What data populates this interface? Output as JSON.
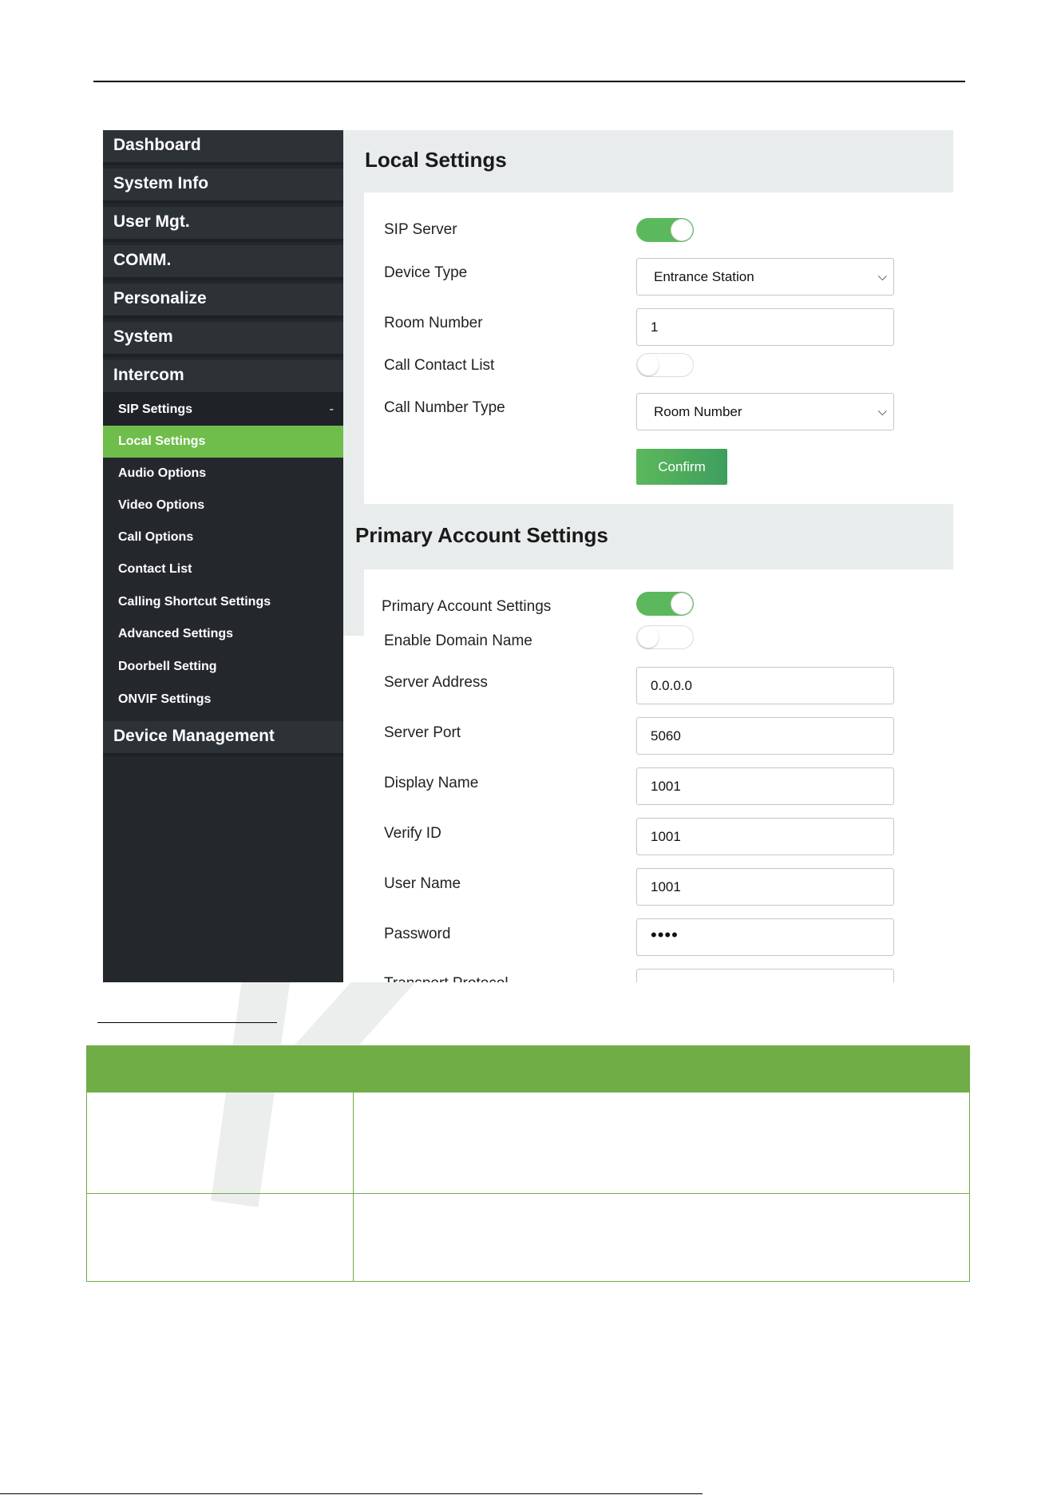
{
  "sidebar": {
    "main_items": [
      {
        "label": "Dashboard"
      },
      {
        "label": "System Info"
      },
      {
        "label": "User Mgt."
      },
      {
        "label": "COMM."
      },
      {
        "label": "Personalize"
      },
      {
        "label": "System"
      },
      {
        "label": "Intercom"
      }
    ],
    "sip_settings": {
      "label": "SIP Settings",
      "toggle_symbol": "-"
    },
    "sub_items": [
      {
        "label": "Local Settings",
        "active": true
      },
      {
        "label": "Audio Options"
      },
      {
        "label": "Video Options"
      },
      {
        "label": "Call Options"
      },
      {
        "label": "Contact List"
      },
      {
        "label": "Calling Shortcut Settings"
      },
      {
        "label": "Advanced Settings"
      },
      {
        "label": "Doorbell Setting"
      },
      {
        "label": "ONVIF Settings"
      }
    ],
    "device_management": {
      "label": "Device Management"
    }
  },
  "local_settings": {
    "title": "Local Settings",
    "sip_server": {
      "label": "SIP Server",
      "enabled": true
    },
    "device_type": {
      "label": "Device Type",
      "value": "Entrance Station"
    },
    "room_number": {
      "label": "Room Number",
      "value": "1"
    },
    "call_contact_list": {
      "label": "Call Contact List",
      "enabled": false
    },
    "call_number_type": {
      "label": "Call Number Type",
      "value": "Room Number"
    },
    "confirm_label": "Confirm"
  },
  "primary_account": {
    "title": "Primary Account Settings",
    "primary_toggle": {
      "label": "Primary Account Settings",
      "enabled": true
    },
    "enable_domain": {
      "label": "Enable Domain Name",
      "enabled": false
    },
    "server_address": {
      "label": "Server Address",
      "value": "0.0.0.0"
    },
    "server_port": {
      "label": "Server Port",
      "value": "5060"
    },
    "display_name": {
      "label": "Display Name",
      "value": "1001"
    },
    "verify_id": {
      "label": "Verify ID",
      "value": "1001"
    },
    "user_name": {
      "label": "User Name",
      "value": "1001"
    },
    "password": {
      "label": "Password",
      "value": "••••"
    },
    "transport_protocol": {
      "label": "Transport Protocol"
    }
  },
  "colors": {
    "sidebar_bg": "#24282c",
    "active_item": "#6fbd4b",
    "toggle_on": "#5cb85c",
    "table_header": "#70ad47"
  },
  "icons": {
    "select_chevron": "chevron-down-icon",
    "toggle": "toggle-switch"
  }
}
